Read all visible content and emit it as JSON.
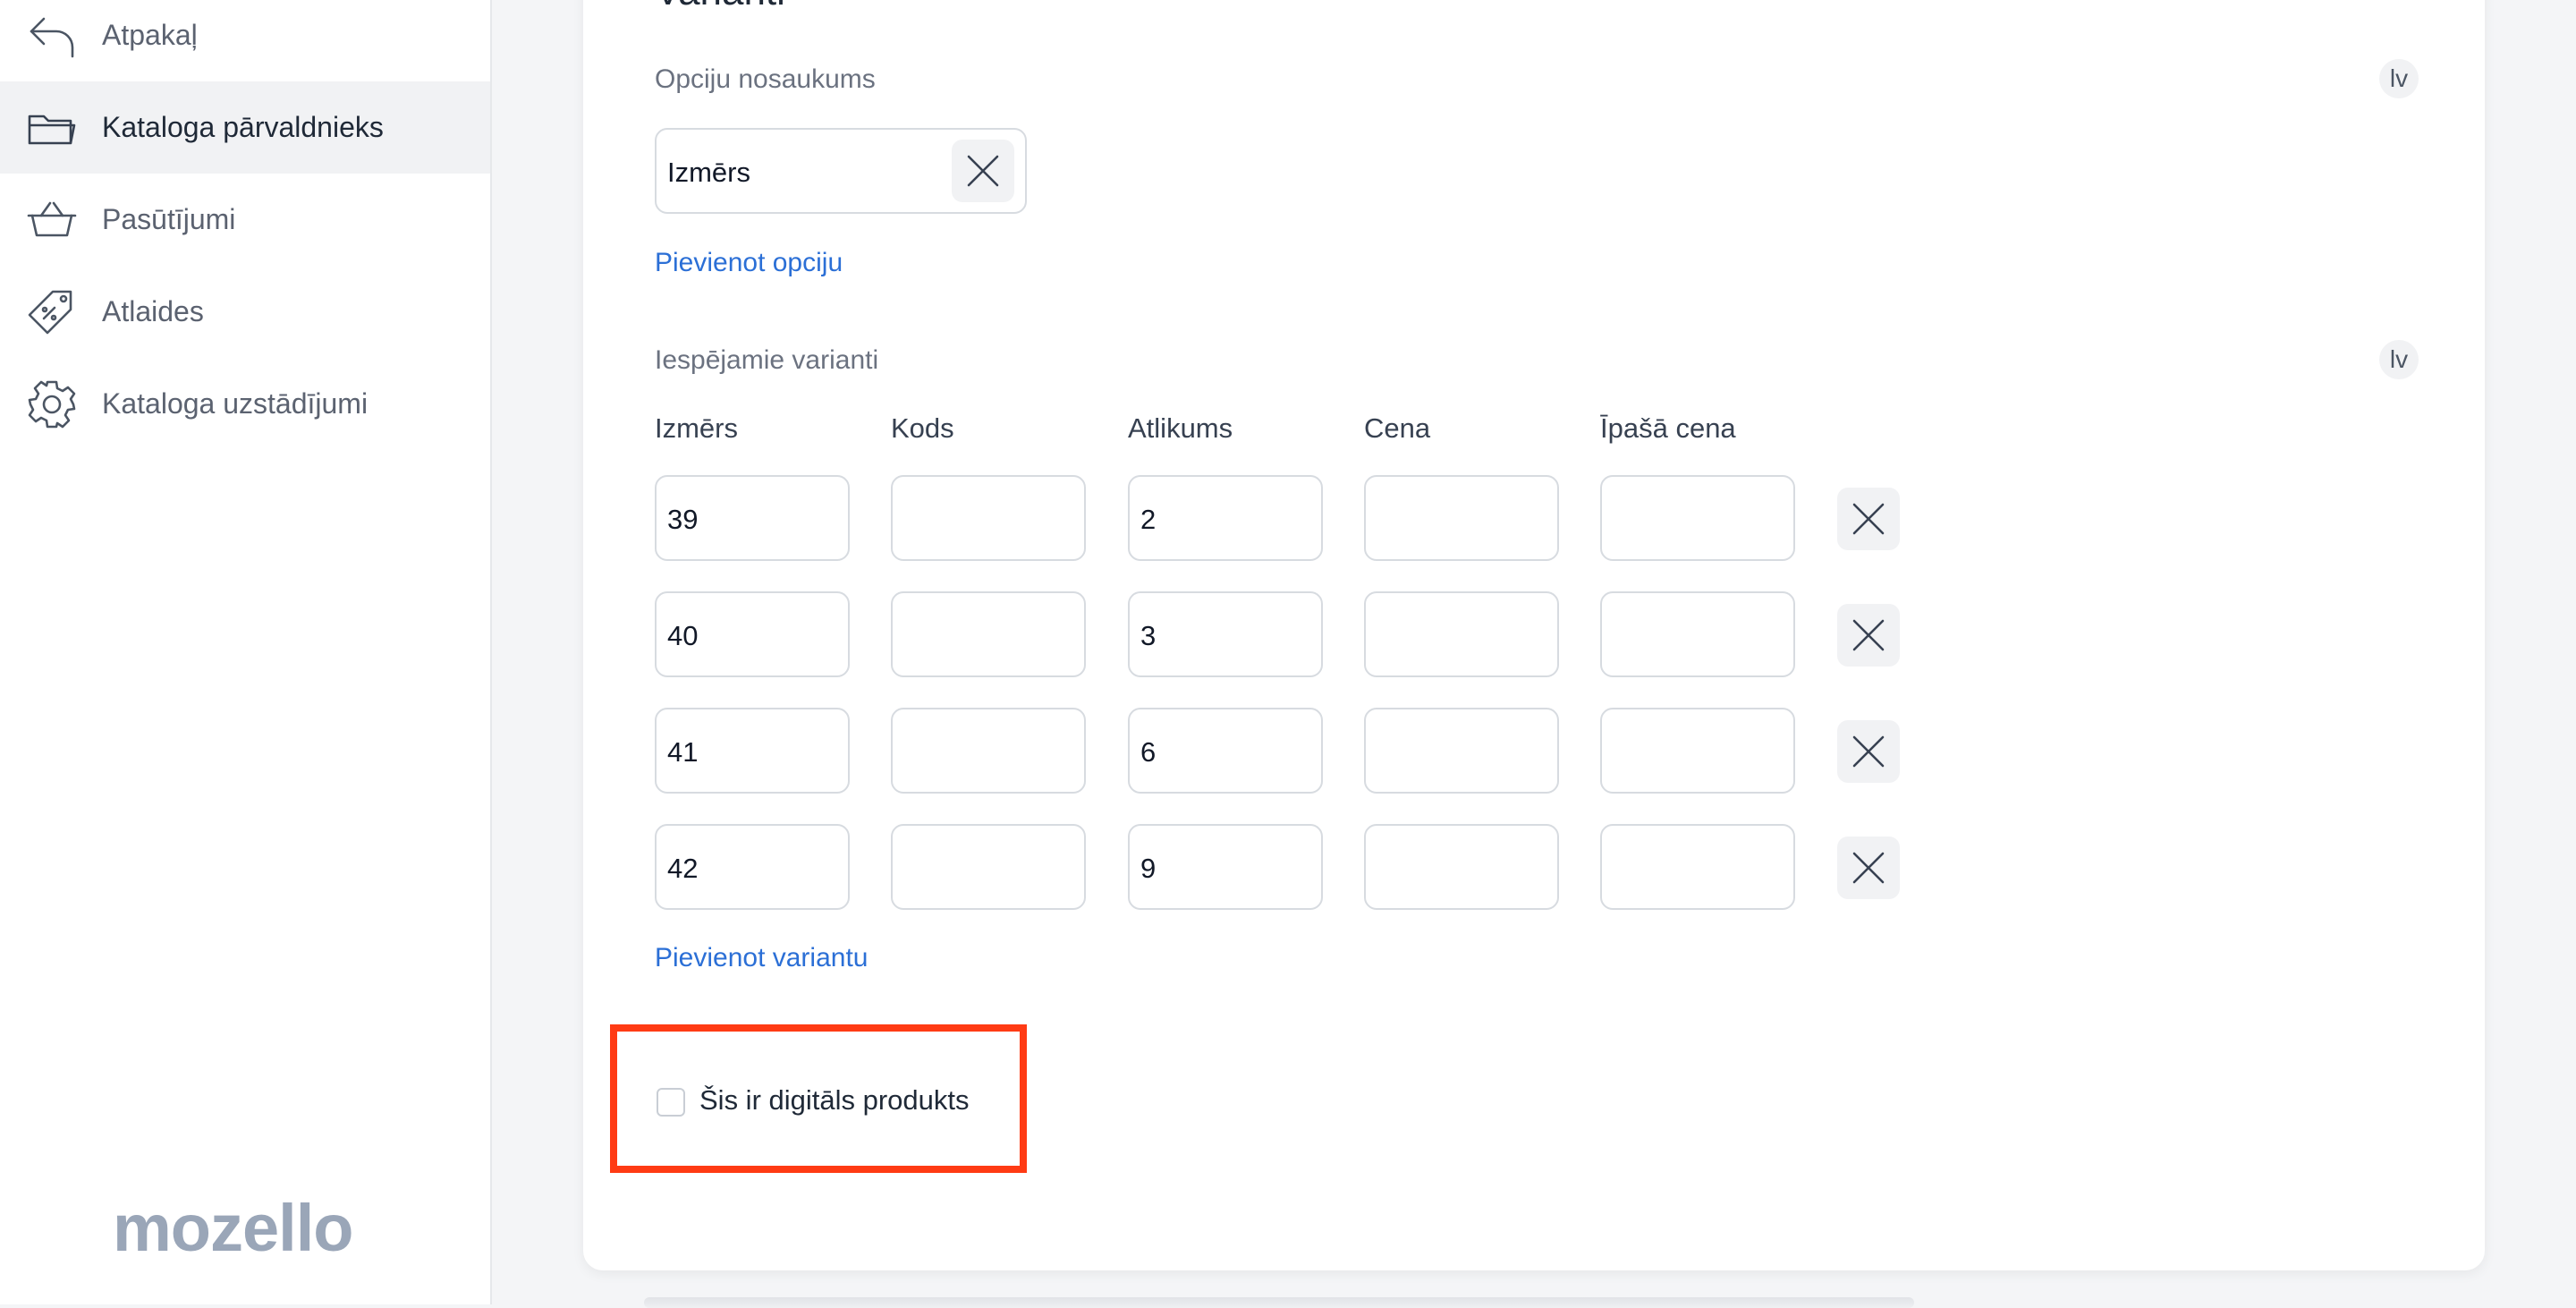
{
  "sidebar": {
    "items": [
      {
        "label": "Atpakaļ",
        "icon": "back-arrow-icon",
        "active": false
      },
      {
        "label": "Kataloga pārvaldnieks",
        "icon": "folder-icon",
        "active": true
      },
      {
        "label": "Pasūtījumi",
        "icon": "basket-icon",
        "active": false
      },
      {
        "label": "Atlaides",
        "icon": "discount-tag-icon",
        "active": false
      },
      {
        "label": "Kataloga uzstādījumi",
        "icon": "gear-icon",
        "active": false
      }
    ],
    "logo": "mozello"
  },
  "variants": {
    "section_title": "Varianti",
    "option_name_label": "Opciju nosaukums",
    "language": "lv",
    "option_value": "Izmērs",
    "add_option_link": "Pievienot opciju",
    "possible_variants_label": "Iespējamie varianti",
    "columns": [
      "Izmērs",
      "Kods",
      "Atlikums",
      "Cena",
      "Īpašā cena"
    ],
    "rows": [
      [
        "39",
        "",
        "2",
        "",
        ""
      ],
      [
        "40",
        "",
        "3",
        "",
        ""
      ],
      [
        "41",
        "",
        "6",
        "",
        ""
      ],
      [
        "42",
        "",
        "9",
        "",
        ""
      ]
    ],
    "add_variant_link": "Pievienot variantu"
  },
  "digital_product": {
    "label": "Šis ir digitāls produkts",
    "checked": false
  },
  "colors": {
    "link": "#2b6fd6",
    "highlight": "#ff3b14",
    "logo": "#9aa6b8"
  }
}
